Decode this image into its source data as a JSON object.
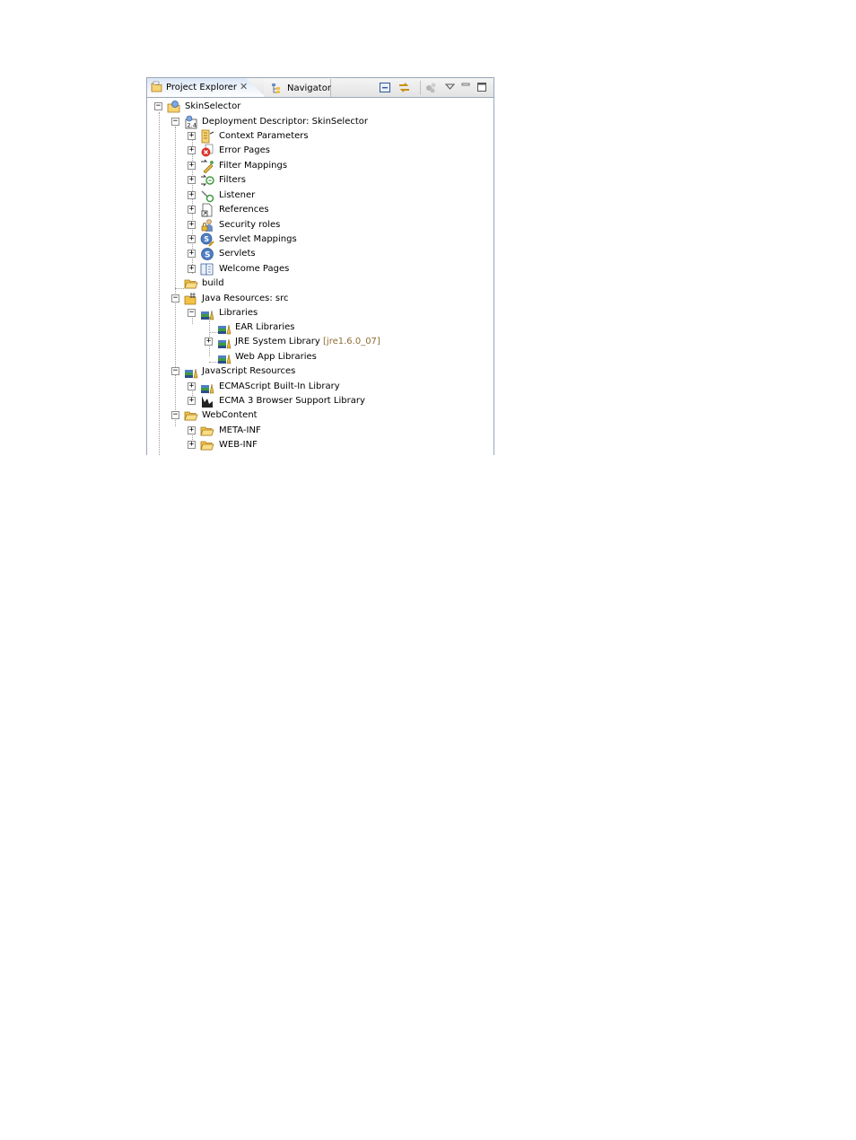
{
  "tabs": {
    "active_label": "Project Explorer",
    "inactive_label": "Navigator"
  },
  "tree": {
    "root": "SkinSelector",
    "deployment_descriptor": "Deployment Descriptor: SkinSelector",
    "dd_children": [
      "Context Parameters",
      "Error Pages",
      "Filter Mappings",
      "Filters",
      "Listener",
      "References",
      "Security roles",
      "Servlet Mappings",
      "Servlets",
      "Welcome Pages"
    ],
    "build": "build",
    "java_resources": "Java Resources: src",
    "libraries": "Libraries",
    "ear_libraries": "EAR Libraries",
    "jre_library": "JRE System Library",
    "jre_decoration": "[jre1.6.0_07]",
    "webapp_libraries": "Web App Libraries",
    "javascript_resources": "JavaScript Resources",
    "ecma_builtin": "ECMAScript Built-In Library",
    "ecma_browser": "ECMA 3 Browser Support Library",
    "webcontent": "WebContent",
    "meta_inf": "META-INF",
    "web_inf": "WEB-INF"
  },
  "colors": {
    "selection": "#3669c3",
    "decoration": "#8e6d34",
    "folder": "#f2c244"
  }
}
